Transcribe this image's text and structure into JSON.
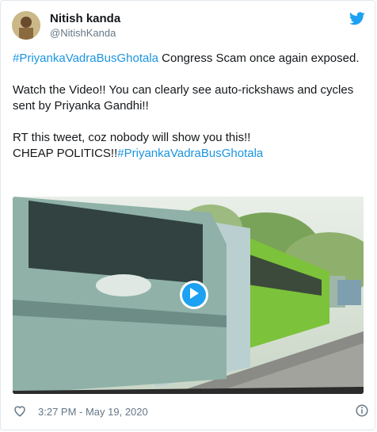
{
  "author": {
    "name": "Nitish kanda",
    "handle": "@NitishKanda"
  },
  "tweet": {
    "p1_hashtag": "#PriyankaVadraBusGhotala",
    "p1_text": " Congress Scam once again exposed.",
    "p2_text": "Watch the Video!! You can clearly see auto-rickshaws and cycles sent by Priyanka Gandhi!!",
    "p3_line1": "RT this tweet, coz nobody will show you this!!",
    "p3_line2_text": "CHEAP POLITICS!!",
    "p3_line2_hashtag": "#PriyankaVadraBusGhotala"
  },
  "footer": {
    "timestamp": "3:27 PM - May 19, 2020"
  },
  "icons": {
    "logo": "twitter-bird-icon",
    "like": "heart-icon",
    "info": "info-icon",
    "play": "play-icon"
  },
  "colors": {
    "link": "#1b95e0",
    "brand": "#1da1f2",
    "muted": "#657786"
  }
}
